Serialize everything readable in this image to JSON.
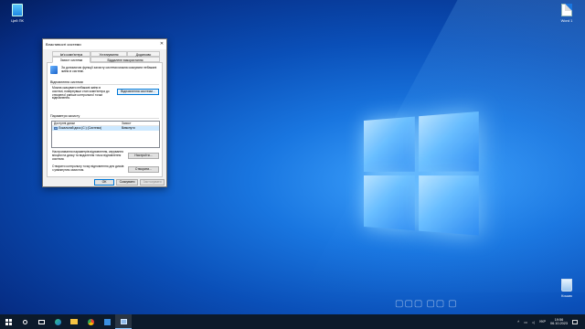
{
  "desktop": {
    "icons": [
      {
        "label": "Цей ПК",
        "kind": "this-pc"
      },
      {
        "label": "Word 1",
        "kind": "document"
      },
      {
        "label": "Кошик",
        "kind": "recycle-bin"
      }
    ]
  },
  "dialog": {
    "title": "Властивості системи",
    "tabs": {
      "computer_name": "Ім'я комп'ютера",
      "hardware": "Устаткування",
      "advanced": "Додатково",
      "system_protection": "Захист системи",
      "remote": "Віддалене використання"
    },
    "intro_text": "За допомогою функції захисту системи можна скасувати небажані зміни в системі.",
    "restore": {
      "group_label": "Відновлення системи",
      "description": "Можна скасувати небажані зміни в системі, повернувши стан комп'ютера до створеної раніше контрольної точки відновлення.",
      "button": "Відновлення системи..."
    },
    "protection": {
      "group_label": "Параметри захисту",
      "columns": [
        "Доступні диски",
        "Захист"
      ],
      "rows": [
        {
          "drive": "Локальний диск (C:) (Система)",
          "status": "Вимкнути"
        }
      ],
      "configure_text": "Настроювання параметрів відновлення, керування місцем на диску та видалення точок відновлення системи.",
      "configure_button": "Настроїти...",
      "create_text": "Створити контрольну точку відновлення для дисків з увімкнутим захистом.",
      "create_button": "Створити..."
    },
    "footer": {
      "ok": "ОК",
      "cancel": "Скасувати",
      "apply": "Застосувати"
    }
  },
  "taskbar": {
    "language": "УКР",
    "time": "19:56",
    "date": "06.10.2023"
  }
}
